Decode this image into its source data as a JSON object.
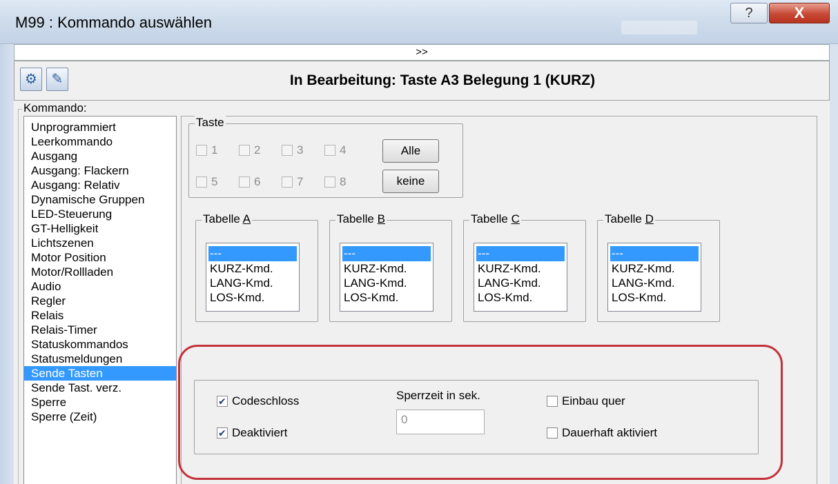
{
  "window": {
    "title": "M99 : Kommando auswählen",
    "help_label": "?",
    "close_label": "X"
  },
  "expander_label": ">>",
  "header": {
    "title": "In Bearbeitung: Taste A3 Belegung 1 (KURZ)",
    "icon1": "program-icon",
    "icon2": "edit-icon"
  },
  "kommando": {
    "legend": "Kommando:",
    "items": [
      "Unprogrammiert",
      "Leerkommando",
      "Ausgang",
      "Ausgang: Flackern",
      "Ausgang: Relativ",
      "Dynamische Gruppen",
      "LED-Steuerung",
      "GT-Helligkeit",
      "Lichtszenen",
      "Motor Position",
      "Motor/Rollladen",
      "Audio",
      "Regler",
      "Relais",
      "Relais-Timer",
      "Statuskommandos",
      "Statusmeldungen",
      "Sende Tasten",
      "Sende Tast. verz.",
      "Sperre",
      "Sperre (Zeit)"
    ],
    "selected": "Sende Tasten"
  },
  "taste": {
    "legend": "Taste",
    "keys": [
      "1",
      "2",
      "3",
      "4",
      "5",
      "6",
      "7",
      "8"
    ],
    "alle_label": "Alle",
    "keine_label": "keine"
  },
  "tables": [
    {
      "prefix": "Tabelle ",
      "letter": "A",
      "items": [
        "---",
        "KURZ-Kmd.",
        "LANG-Kmd.",
        "LOS-Kmd."
      ]
    },
    {
      "prefix": "Tabelle ",
      "letter": "B",
      "items": [
        "---",
        "KURZ-Kmd.",
        "LANG-Kmd.",
        "LOS-Kmd."
      ]
    },
    {
      "prefix": "Tabelle ",
      "letter": "C",
      "items": [
        "---",
        "KURZ-Kmd.",
        "LANG-Kmd.",
        "LOS-Kmd."
      ]
    },
    {
      "prefix": "Tabelle ",
      "letter": "D",
      "items": [
        "---",
        "KURZ-Kmd.",
        "LANG-Kmd.",
        "LOS-Kmd."
      ]
    }
  ],
  "options": {
    "codeschloss_label": "Codeschloss",
    "codeschloss_checked": true,
    "deaktiviert_label": "Deaktiviert",
    "deaktiviert_checked": true,
    "sperrzeit_label": "Sperrzeit in sek.",
    "sperrzeit_value": "0",
    "einbau_label": "Einbau quer",
    "einbau_checked": false,
    "dauerhaft_label": "Dauerhaft aktiviert",
    "dauerhaft_checked": false,
    "highlight_color": "#c3313a"
  },
  "colors": {
    "selection": "#3399ff",
    "titlebar": "#cfdceb"
  }
}
